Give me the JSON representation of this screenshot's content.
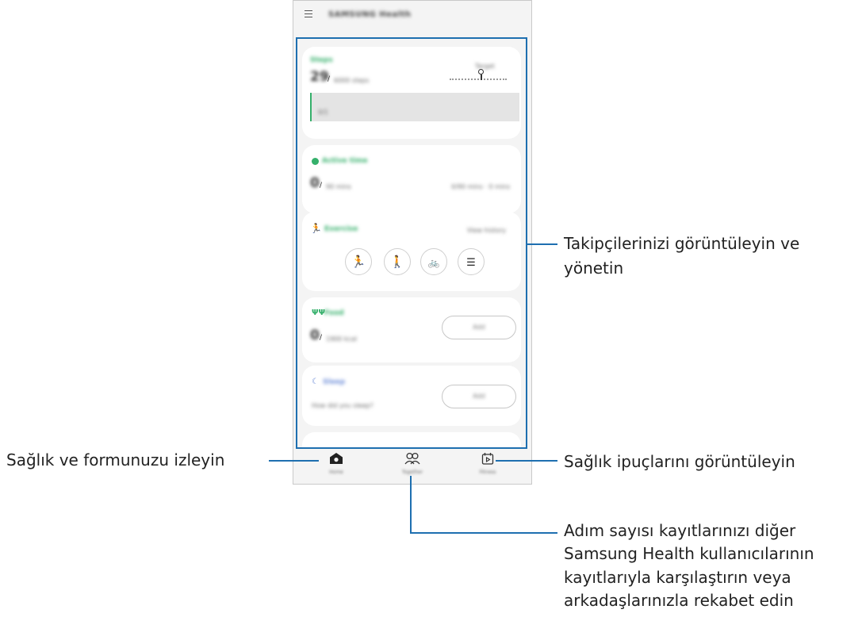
{
  "app": {
    "title": "SAMSUNG Health"
  },
  "cards": {
    "steps": {
      "title": "Steps",
      "count": "29",
      "goal": "6000 steps",
      "goal_marker": "Target",
      "note": "0/1"
    },
    "active_time": {
      "title": "Active time",
      "value": "0",
      "unit": "90 mins",
      "detail": "0/90 mins · 0 mins"
    },
    "exercise": {
      "title": "Exercise",
      "link": "View history"
    },
    "food": {
      "title": "Food",
      "value": "0",
      "unit": "1900 kcal",
      "button": "Add"
    },
    "sleep": {
      "title": "Sleep",
      "prompt": "How did you sleep?",
      "button": "Add"
    }
  },
  "nav": {
    "home": "Home",
    "together": "Together",
    "fitness": "Fitness"
  },
  "callouts": {
    "followers_line1": "Takipçilerinizi görüntüleyin ve",
    "followers_line2": "yönetin",
    "health": "Sağlık ve formunuzu izleyin",
    "tips": "Sağlık ipuçlarını görüntüleyin",
    "steps_line1": "Adım sayısı kayıtlarınızı diğer",
    "steps_line2": "Samsung Health kullanıcılarının",
    "steps_line3": "kayıtlarıyla karşılaştırın veya",
    "steps_line4": "arkadaşlarınızla rekabet edin"
  },
  "colors": {
    "accent_green": "#35b06b",
    "callout_blue": "#1e6fb0",
    "sleep_blue": "#6f8ed8"
  }
}
